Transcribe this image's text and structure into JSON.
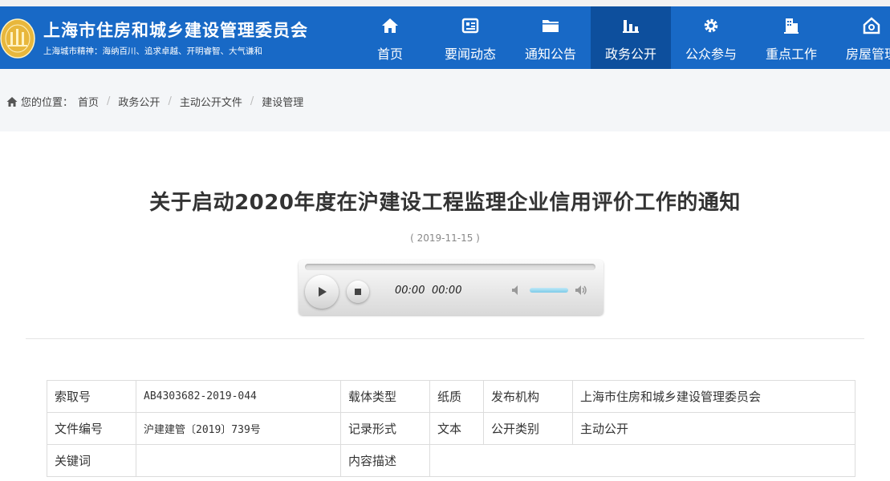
{
  "header": {
    "site_title": "上海市住房和城乡建设管理委员会",
    "slogan": "上海城市精神：海纳百川、追求卓越、开明睿智、大气谦和",
    "nav": [
      {
        "label": "首页",
        "icon": "home-icon",
        "active": false
      },
      {
        "label": "要闻动态",
        "icon": "news-icon",
        "active": false
      },
      {
        "label": "通知公告",
        "icon": "folder-icon",
        "active": false
      },
      {
        "label": "政务公开",
        "icon": "chart-icon",
        "active": true
      },
      {
        "label": "公众参与",
        "icon": "gear-icon",
        "active": false
      },
      {
        "label": "重点工作",
        "icon": "building-icon",
        "active": false
      },
      {
        "label": "房屋管理",
        "icon": "house-icon",
        "active": false
      }
    ],
    "bg_color": "#1869c6",
    "active_color": "#0d4f9d"
  },
  "breadcrumb": {
    "prefix": "您的位置：",
    "items": [
      "首页",
      "政务公开",
      "主动公开文件",
      "建设管理"
    ],
    "separator": "/"
  },
  "article": {
    "title": "关于启动2020年度在沪建设工程监理企业信用评价工作的通知",
    "date": "( 2019-11-15 )"
  },
  "player": {
    "current_time": "00:00",
    "duration": "00:00",
    "volume": 0.8
  },
  "meta_table": {
    "rows": [
      {
        "c1": "索取号",
        "c2": "AB4303682-2019-044",
        "c3": "载体类型",
        "c4": "纸质",
        "c5": "发布机构",
        "c6": "上海市住房和城乡建设管理委员会"
      },
      {
        "c1": "文件编号",
        "c2": "沪建建管〔2019〕739号",
        "c3": "记录形式",
        "c4": "文本",
        "c5": "公开类别",
        "c6": "主动公开"
      },
      {
        "c1": "关键词",
        "c2": "",
        "c3": "内容描述",
        "c4": ""
      }
    ]
  }
}
